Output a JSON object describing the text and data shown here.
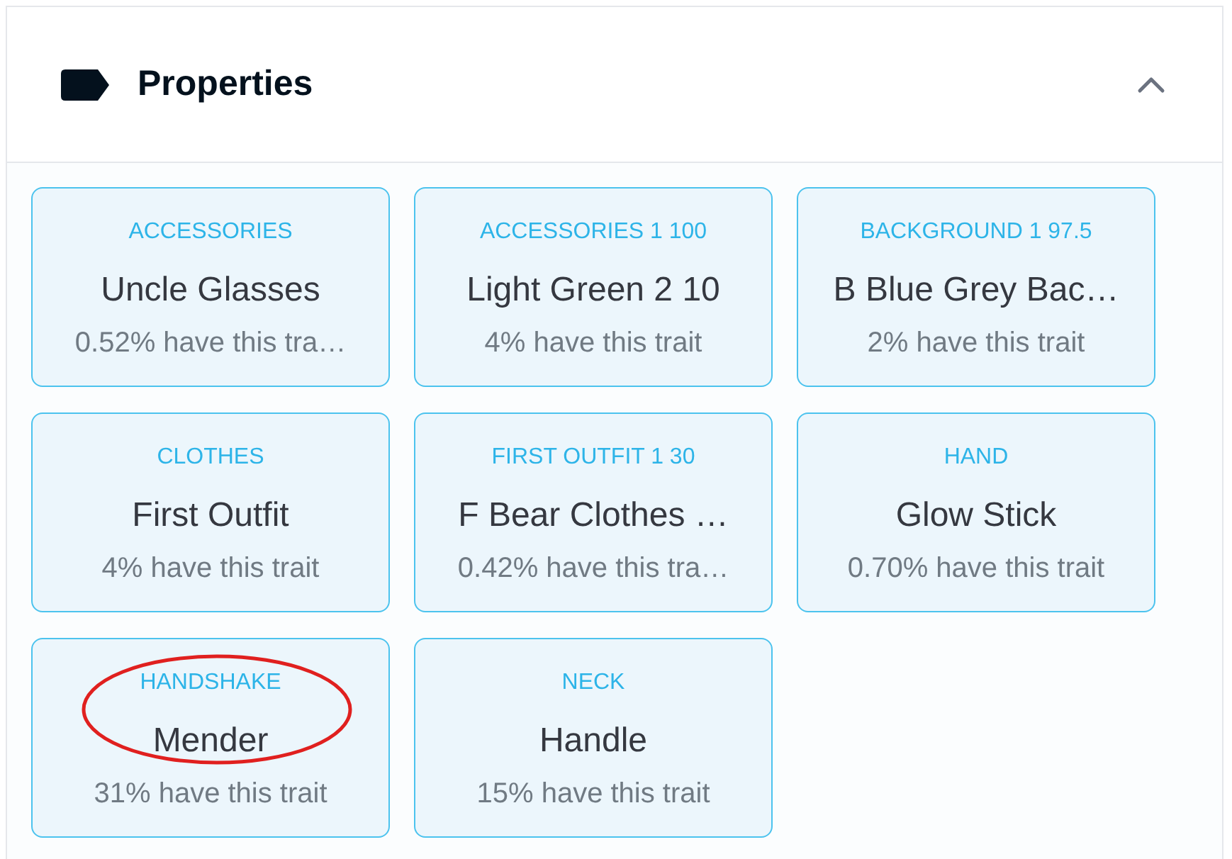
{
  "panel": {
    "title": "Properties",
    "expanded": true
  },
  "properties": [
    {
      "type": "ACCESSORIES",
      "value": "Uncle Glasses",
      "rarity": "0.52% have this tra…",
      "highlighted": false
    },
    {
      "type": "ACCESSORIES 1 100",
      "value": "Light Green 2 10",
      "rarity": "4% have this trait",
      "highlighted": false
    },
    {
      "type": "BACKGROUND 1 97.5",
      "value": "B Blue Grey Bac…",
      "rarity": "2% have this trait",
      "highlighted": false
    },
    {
      "type": "CLOTHES",
      "value": "First Outfit",
      "rarity": "4% have this trait",
      "highlighted": false
    },
    {
      "type": "FIRST OUTFIT 1 30",
      "value": "F Bear Clothes …",
      "rarity": "0.42% have this tra…",
      "highlighted": false
    },
    {
      "type": "HAND",
      "value": "Glow Stick",
      "rarity": "0.70% have this trait",
      "highlighted": false
    },
    {
      "type": "HANDSHAKE",
      "value": "Mender",
      "rarity": "31% have this trait",
      "highlighted": true
    },
    {
      "type": "NECK",
      "value": "Handle",
      "rarity": "15% have this trait",
      "highlighted": false
    }
  ]
}
